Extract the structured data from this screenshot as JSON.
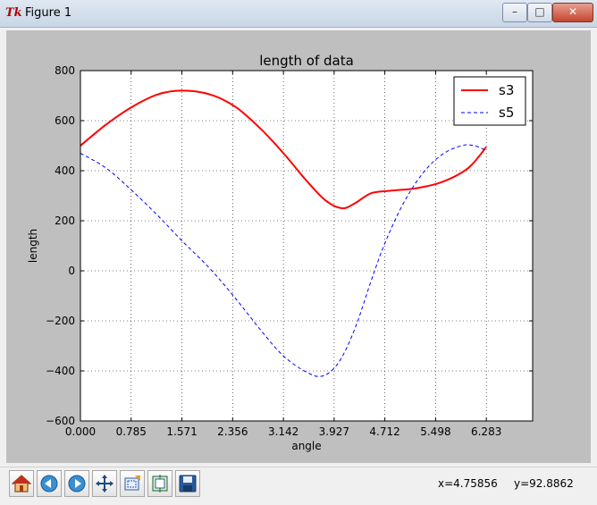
{
  "window": {
    "title": "Figure 1",
    "controls": {
      "minimize": "–",
      "maximize": "□",
      "close": "✕"
    }
  },
  "toolbar": {
    "buttons": [
      {
        "name": "home-icon"
      },
      {
        "name": "back-icon"
      },
      {
        "name": "forward-icon"
      },
      {
        "name": "pan-icon"
      },
      {
        "name": "zoom-icon"
      },
      {
        "name": "subplots-icon"
      },
      {
        "name": "save-icon"
      }
    ],
    "coord_x": "x=4.75856",
    "coord_y": "y=92.8862"
  },
  "chart_data": {
    "type": "line",
    "title": "length of data",
    "xlabel": "angle",
    "ylabel": "length",
    "xlim": [
      0,
      7.0
    ],
    "ylim": [
      -600,
      800
    ],
    "xticks": [
      0.0,
      0.785,
      1.571,
      2.356,
      3.142,
      3.927,
      4.712,
      5.498,
      6.283
    ],
    "xtick_labels": [
      "0.000",
      "0.785",
      "1.571",
      "2.356",
      "3.142",
      "3.927",
      "4.712",
      "5.498",
      "6.283"
    ],
    "yticks": [
      -600,
      -400,
      -200,
      0,
      200,
      400,
      600,
      800
    ],
    "ytick_labels": [
      "−600",
      "−400",
      "−200",
      "0",
      "200",
      "400",
      "600",
      "800"
    ],
    "grid": true,
    "legend_position": "top-right",
    "series": [
      {
        "name": "s3",
        "color": "#ff0000",
        "style": "solid",
        "x": [
          0.0,
          0.4,
          0.8,
          1.2,
          1.571,
          2.0,
          2.4,
          2.8,
          3.142,
          3.5,
          3.8,
          4.05,
          4.25,
          4.5,
          4.8,
          5.2,
          5.6,
          6.0,
          6.283
        ],
        "y": [
          500,
          585,
          655,
          705,
          720,
          705,
          655,
          565,
          470,
          360,
          280,
          250,
          270,
          310,
          320,
          330,
          355,
          410,
          495
        ]
      },
      {
        "name": "s5",
        "color": "#0000ff",
        "style": "dashed",
        "x": [
          0.0,
          0.4,
          0.8,
          1.2,
          1.571,
          2.0,
          2.4,
          2.8,
          3.142,
          3.5,
          3.75,
          4.0,
          4.25,
          4.5,
          4.712,
          5.0,
          5.3,
          5.6,
          5.9,
          6.1,
          6.283
        ],
        "y": [
          470,
          410,
          320,
          220,
          120,
          10,
          -110,
          -240,
          -340,
          -405,
          -420,
          -365,
          -230,
          -40,
          110,
          270,
          390,
          465,
          500,
          500,
          480
        ]
      }
    ]
  }
}
